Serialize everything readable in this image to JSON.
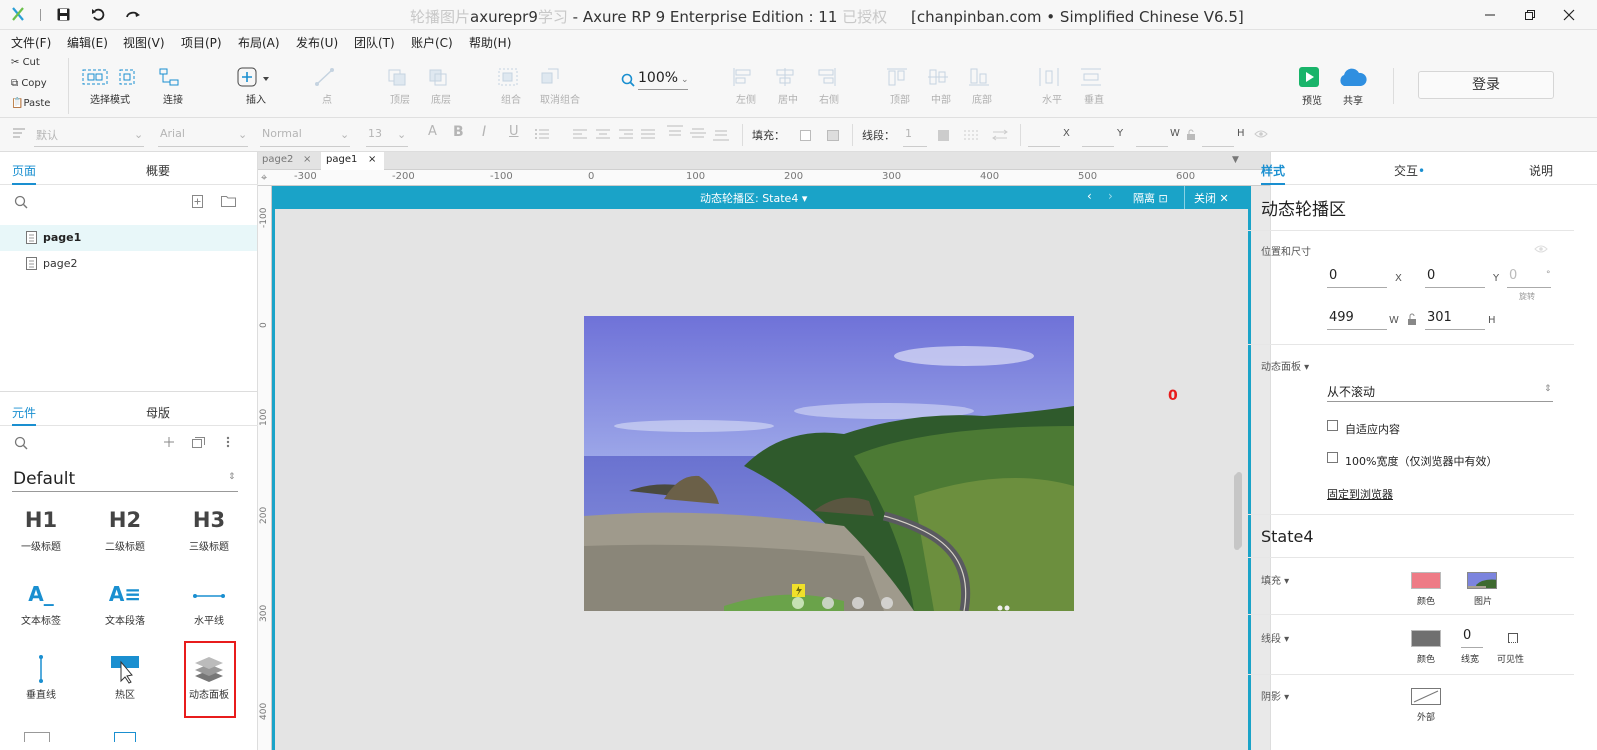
{
  "window": {
    "title_gray_pre": "轮播图片",
    "title_dark": "axurepr9",
    "title_gray_mid": "学习",
    "title_main": " - Axure RP 9 Enterprise Edition : 11 ",
    "title_gray_post": "已授权",
    "title_site": "[chanpinban.com • Simplified Chinese V6.5]"
  },
  "menu": [
    "文件(F)",
    "编辑(E)",
    "视图(V)",
    "项目(P)",
    "布局(A)",
    "发布(U)",
    "团队(T)",
    "账户(C)",
    "帮助(H)"
  ],
  "clipboard": {
    "cut": "Cut",
    "copy": "Copy",
    "paste": "Paste"
  },
  "toolbar": {
    "select_mode": "选择模式",
    "connect": "连接",
    "insert": "插入",
    "point": "点",
    "top_layer": "顶层",
    "bottom_layer": "底层",
    "group": "组合",
    "ungroup": "取消组合",
    "zoom": "100%",
    "align_left": "左侧",
    "align_center": "居中",
    "align_right": "右侧",
    "align_top": "顶部",
    "align_middle": "中部",
    "align_bottom": "底部",
    "dist_h": "水平",
    "dist_v": "垂直",
    "preview": "预览",
    "share": "共享",
    "login": "登录"
  },
  "stylebar": {
    "style": "默认",
    "font": "Arial",
    "weight": "Normal",
    "size": "13",
    "fill_label": "填充：",
    "stroke_label": "线段：",
    "stroke_value": "1",
    "x_label": "X",
    "y_label": "Y",
    "w_label": "W",
    "h_label": "H"
  },
  "left": {
    "tab_pages": "页面",
    "tab_outline": "概要",
    "pages": [
      "page1",
      "page2"
    ],
    "tab_widgets": "元件",
    "tab_masters": "母版",
    "library": "Default",
    "widgets": [
      {
        "glyph": "H1",
        "label": "一级标题"
      },
      {
        "glyph": "H2",
        "label": "二级标题"
      },
      {
        "glyph": "H3",
        "label": "三级标题"
      },
      {
        "glyph": "A_",
        "label": "文本标签"
      },
      {
        "glyph": "A≡",
        "label": "文本段落"
      },
      {
        "glyph": "",
        "label": "水平线"
      },
      {
        "glyph": "",
        "label": "垂直线"
      },
      {
        "glyph": "",
        "label": "热区"
      },
      {
        "glyph": "",
        "label": "动态面板"
      }
    ]
  },
  "canvas": {
    "tabs": [
      "page2",
      "page1"
    ],
    "ruler_h": [
      "-300",
      "-200",
      "-100",
      "0",
      "100",
      "200",
      "300",
      "400",
      "500",
      "600"
    ],
    "ruler_v": [
      "-100",
      "0",
      "100",
      "200",
      "300",
      "400"
    ],
    "panel_name": "动态轮播区: State4",
    "isolate": "隔离",
    "close": "关闭",
    "red_marker": "0"
  },
  "right": {
    "tab_style": "样式",
    "tab_interact": "交互",
    "tab_notes": "说明",
    "widget_name": "动态轮播区",
    "pos_size_label": "位置和尺寸",
    "x": "0",
    "y": "0",
    "rotation": "0",
    "x_lbl": "X",
    "y_lbl": "Y",
    "rot_lbl": "旋转",
    "w": "499",
    "h": "301",
    "w_lbl": "W",
    "h_lbl": "H",
    "dp_label": "动态面板",
    "scroll": "从不滚动",
    "fit_content": "自适应内容",
    "full_width": "100%宽度（仅浏览器中有效）",
    "pin": "固定到浏览器",
    "state_name": "State4",
    "fill_label": "填充",
    "color_lbl": "颜色",
    "image_lbl": "图片",
    "stroke_label": "线段",
    "stroke_width": "0",
    "stroke_width_lbl": "线宽",
    "visibility_lbl": "可见性",
    "shadow_label": "阴影",
    "outer_lbl": "外部"
  },
  "colors": {
    "accent": "#1aa3c8",
    "tab_blue": "#1a8fd0",
    "fill_swatch": "#ee7b86",
    "stroke_swatch": "#707070",
    "highlight": "#e81c1c"
  }
}
